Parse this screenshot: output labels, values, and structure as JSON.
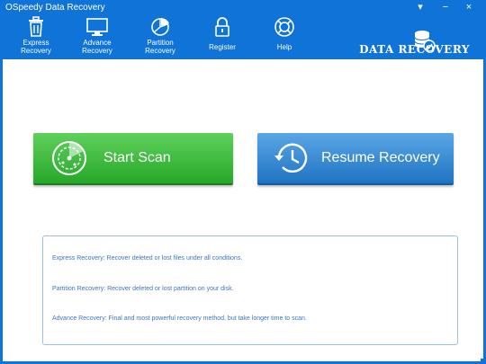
{
  "window": {
    "title": "OSpeedy Data Recovery",
    "controls": {
      "menu": "▾",
      "minimize": "−",
      "close": "×"
    }
  },
  "toolbar": {
    "items": [
      {
        "label": "Express\nRecovery",
        "icon": "trash-icon"
      },
      {
        "label": "Advance\nRecovery",
        "icon": "monitor-icon"
      },
      {
        "label": "Partition\nRecovery",
        "icon": "pie-chart-icon"
      },
      {
        "label": "Register",
        "icon": "lock-icon"
      },
      {
        "label": "Help",
        "icon": "lifebuoy-icon"
      }
    ]
  },
  "brand": {
    "text": "DATA RECOVERY",
    "icon": "database-check-icon"
  },
  "main": {
    "start_scan": {
      "label": "Start Scan",
      "icon": "radar-icon"
    },
    "resume_recovery": {
      "label": "Resume Recovery",
      "icon": "history-clock-icon"
    },
    "info_lines": [
      "Express Recovery: Recover deleted or lost files  under all conditions.",
      "Partition Recovery: Recover deleted or lost partition on your disk.",
      "Advance Recovery: Final and most powerful recovery method, but take longer time to scan."
    ]
  },
  "colors": {
    "frame": "#0f73d7",
    "start_green": "#2fb030",
    "resume_blue": "#2a7ed0",
    "info_text": "#3a76c3"
  }
}
